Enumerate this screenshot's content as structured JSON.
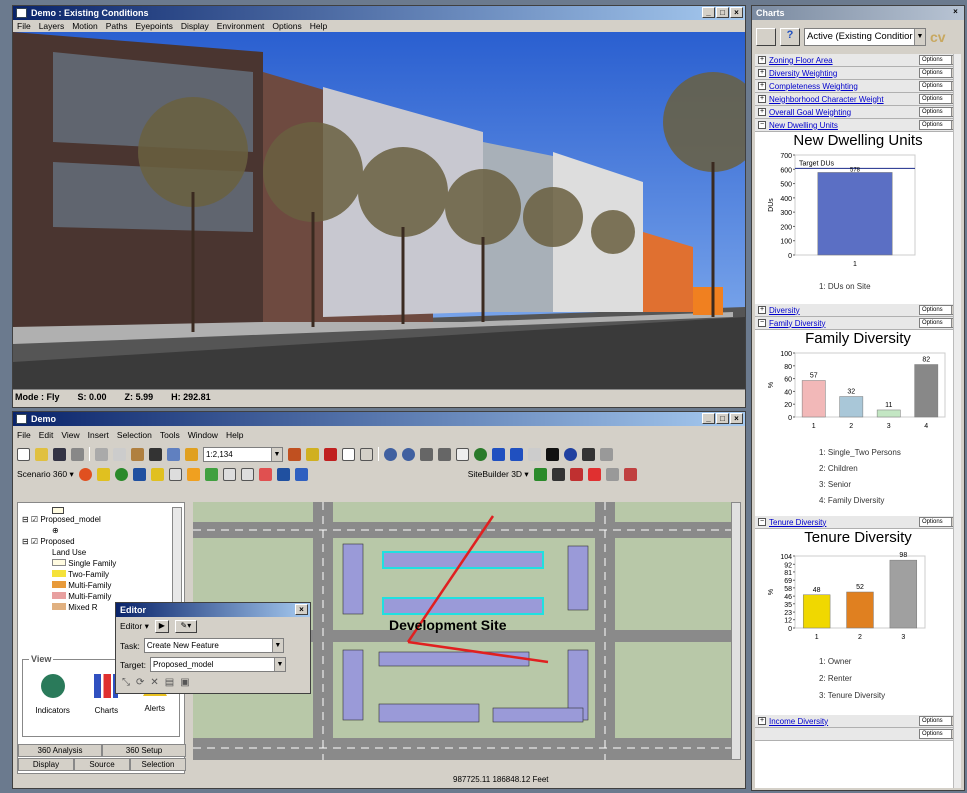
{
  "top_window": {
    "title": "Demo : Existing Conditions",
    "menu": [
      "File",
      "Layers",
      "Motion",
      "Paths",
      "Eyepoints",
      "Display",
      "Environment",
      "Options",
      "Help"
    ],
    "status": {
      "mode": "Mode : Fly",
      "s": "S:",
      "s_val": "0.00",
      "z": "Z:",
      "z_val": "5.99",
      "h": "H: 292.81"
    }
  },
  "gis_window": {
    "title": "Demo",
    "menu": [
      "File",
      "Edit",
      "View",
      "Insert",
      "Selection",
      "Tools",
      "Window",
      "Help"
    ],
    "scale": "1:2,134",
    "scenario": "Scenario 360 ▾",
    "sitebuilder": "SiteBuilder 3D ▾",
    "coords": "987725.11  186848.12 Feet"
  },
  "toc": {
    "items": [
      {
        "label": "Proposed_model"
      },
      {
        "label": "Proposed"
      },
      {
        "label": "Land Use"
      },
      {
        "label": "Single Family",
        "color": "#fffbe0"
      },
      {
        "label": "Two-Family",
        "color": "#f5e23a"
      },
      {
        "label": "Multi-Family",
        "color": "#e89a3a"
      },
      {
        "label": "Multi-Family",
        "color": "#e8a0a0"
      },
      {
        "label": "Mixed R",
        "color": "#e0b080"
      }
    ],
    "view_panel": {
      "title": "View",
      "buttons": [
        "Indicators",
        "Charts",
        "Alerts"
      ]
    },
    "tabs_row1": [
      "360 Analysis",
      "360 Setup"
    ],
    "tabs_row2": [
      "Display",
      "Source",
      "Selection"
    ]
  },
  "editor": {
    "title": "Editor",
    "editor_label": "Editor ▾",
    "task_label": "Task:",
    "task_value": "Create New Feature",
    "target_label": "Target:",
    "target_value": "Proposed_model"
  },
  "map": {
    "label": "Development Site"
  },
  "charts_panel": {
    "title": "Charts",
    "active": "Active (Existing Conditior",
    "rows_top": [
      "Zoning Floor Area",
      "Diversity Weighting",
      "Completeness Weighting",
      "Neighborhood Character Weight",
      "Overall Goal Weighting",
      "New Dwelling Units"
    ],
    "option_label": "Options",
    "rows_mid": [
      "Diversity",
      "Family Diversity"
    ],
    "rows_tenure": [
      "Tenure Diversity"
    ],
    "rows_bottom": [
      "Income Diversity"
    ]
  },
  "chart_data": [
    {
      "type": "bar",
      "title": "New Dwelling Units",
      "categories": [
        "1"
      ],
      "values": [
        578
      ],
      "ylabel": "DUs",
      "ylim": [
        0,
        700
      ],
      "yticks": [
        "700",
        "600",
        "500",
        "400",
        "300",
        "200",
        "100",
        "0"
      ],
      "target_label": "Target DUs",
      "target_value": "578",
      "legend": [
        "1: DUs on Site"
      ],
      "colors": [
        "#5b6fc4"
      ]
    },
    {
      "type": "bar",
      "title": "Family Diversity",
      "categories": [
        "1",
        "2",
        "3",
        "4"
      ],
      "values": [
        57,
        32,
        11,
        82
      ],
      "ylabel": "%",
      "ylim": [
        0,
        100
      ],
      "yticks": [
        "100",
        "80",
        "60",
        "40",
        "20",
        "0"
      ],
      "legend": [
        "1: Single_Two Persons",
        "2: Children",
        "3: Senior",
        "4: Family Diversity"
      ],
      "colors": [
        "#f2b8b8",
        "#a9c7d8",
        "#c3e6c3",
        "#888888"
      ]
    },
    {
      "type": "bar",
      "title": "Tenure Diversity",
      "categories": [
        "1",
        "2",
        "3"
      ],
      "values": [
        48,
        52,
        98
      ],
      "ylabel": "%",
      "ylim": [
        0,
        104
      ],
      "yticks": [
        "104",
        "92",
        "81",
        "69",
        "58",
        "46",
        "35",
        "23",
        "12",
        "0"
      ],
      "legend": [
        "1: Owner",
        "2: Renter",
        "3: Tenure Diversity"
      ],
      "colors": [
        "#f0d800",
        "#e08020",
        "#a0a0a0"
      ]
    }
  ]
}
